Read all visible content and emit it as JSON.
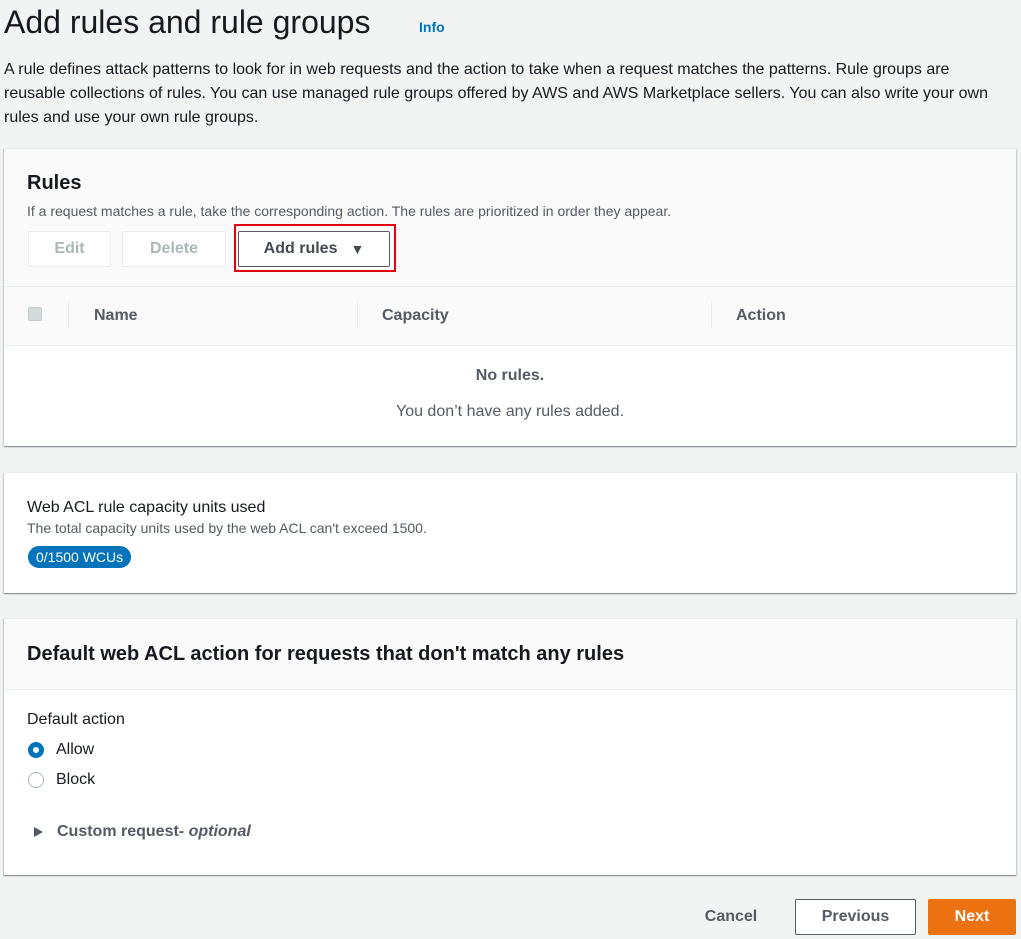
{
  "header": {
    "title": "Add rules and rule groups",
    "info_label": "Info",
    "description": "A rule defines attack patterns to look for in web requests and the action to take when a request matches the patterns. Rule groups are reusable collections of rules. You can use managed rule groups offered by AWS and AWS Marketplace sellers. You can also write your own rules and use your own rule groups."
  },
  "rules_panel": {
    "title": "Rules",
    "description": "If a request matches a rule, take the corresponding action. The rules are prioritized in order they appear.",
    "edit_label": "Edit",
    "delete_label": "Delete",
    "add_rules_label": "Add rules",
    "add_rules_caret": "▼",
    "columns": [
      "Name",
      "Capacity",
      "Action"
    ],
    "empty_title": "No rules.",
    "empty_description": "You don’t have any rules added."
  },
  "wcu_panel": {
    "title": "Web ACL rule capacity units used",
    "description": "The total capacity units used by the web ACL can't exceed 1500.",
    "badge": "0/1500 WCUs"
  },
  "default_action_panel": {
    "title": "Default web ACL action for requests that don't match any rules",
    "field_label": "Default action",
    "options": [
      "Allow",
      "Block"
    ],
    "selected": "Allow",
    "expander_label": "Custom request",
    "expander_optional": " - optional"
  },
  "footer": {
    "cancel_label": "Cancel",
    "previous_label": "Previous",
    "next_label": "Next"
  },
  "colors": {
    "accent": "#0073bb",
    "primary_button": "#ec7211",
    "highlight": "#e3000f"
  }
}
